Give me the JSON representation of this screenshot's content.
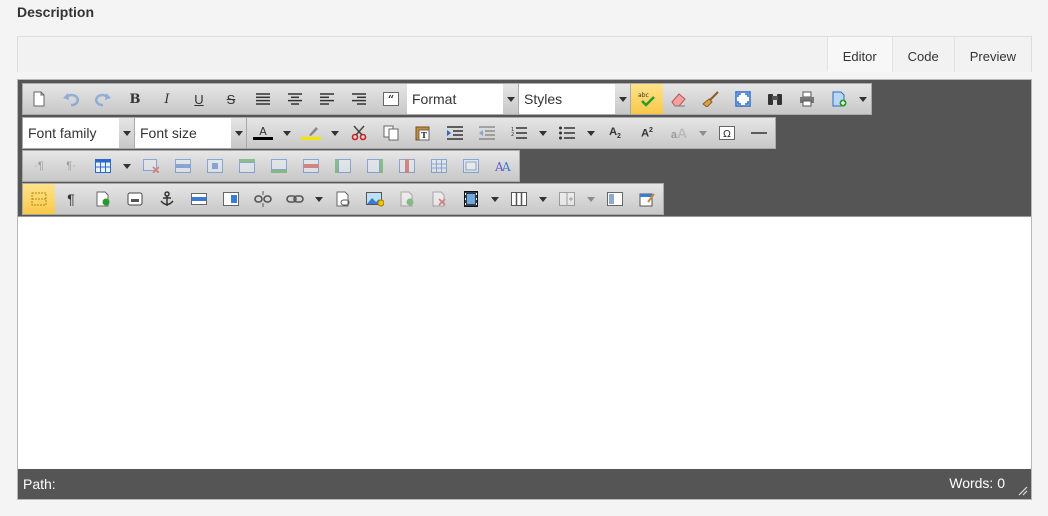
{
  "section_title": "Description",
  "tabs": [
    {
      "label": "Editor"
    },
    {
      "label": "Code"
    },
    {
      "label": "Preview"
    }
  ],
  "toolbar": {
    "format_label": "Format",
    "styles_label": "Styles",
    "font_family_label": "Font family",
    "font_size_label": "Font size"
  },
  "statusbar": {
    "path_label": "Path:",
    "words_label": "Words: 0"
  },
  "colors": {
    "toolbar_bg": "#555555",
    "selected": "#f9c84a",
    "accent_blue": "#3a7bd5",
    "text_color_bar": "#000000",
    "highlight_bar": "#f5e400"
  }
}
